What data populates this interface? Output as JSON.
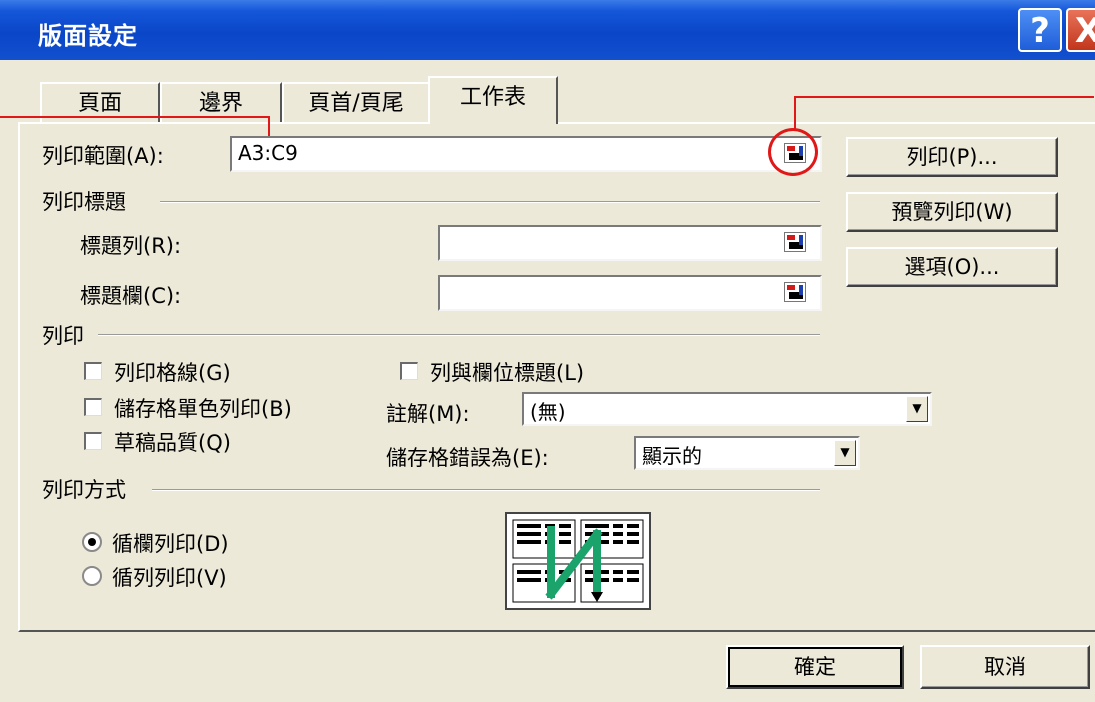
{
  "window": {
    "title": "版面設定",
    "help_icon": "?",
    "close_icon": "X"
  },
  "tabs": [
    {
      "label": "頁面"
    },
    {
      "label": "邊界"
    },
    {
      "label": "頁首/頁尾"
    },
    {
      "label": "工作表",
      "active": true
    }
  ],
  "print_area": {
    "label": "列印範圍(A):",
    "value": "A3:C9"
  },
  "print_titles": {
    "section_label": "列印標題",
    "rows_label": "標題列(R):",
    "rows_value": "",
    "cols_label": "標題欄(C):",
    "cols_value": ""
  },
  "print": {
    "section_label": "列印",
    "gridlines": {
      "label": "列印格線(G)",
      "checked": false
    },
    "black_white": {
      "label": "儲存格單色列印(B)",
      "checked": false
    },
    "draft": {
      "label": "草稿品質(Q)",
      "checked": false
    },
    "row_col_headings": {
      "label": "列與欄位標題(L)",
      "checked": false
    },
    "comments_label": "註解(M):",
    "comments_value": "(無)",
    "errors_label": "儲存格錯誤為(E):",
    "errors_value": "顯示的"
  },
  "page_order": {
    "section_label": "列印方式",
    "down_then_over": {
      "label": "循欄列印(D)",
      "selected": true
    },
    "over_then_down": {
      "label": "循列列印(V)",
      "selected": false
    }
  },
  "side_buttons": {
    "print": "列印(P)...",
    "preview": "預覽列印(W)",
    "options": "選項(O)..."
  },
  "footer": {
    "ok": "確定",
    "cancel": "取消"
  },
  "colors": {
    "titlebar": "#0a46c8",
    "dialog_bg": "#ece9d8",
    "annotation_red": "#e01818",
    "order_arrow": "#1aa36a"
  }
}
